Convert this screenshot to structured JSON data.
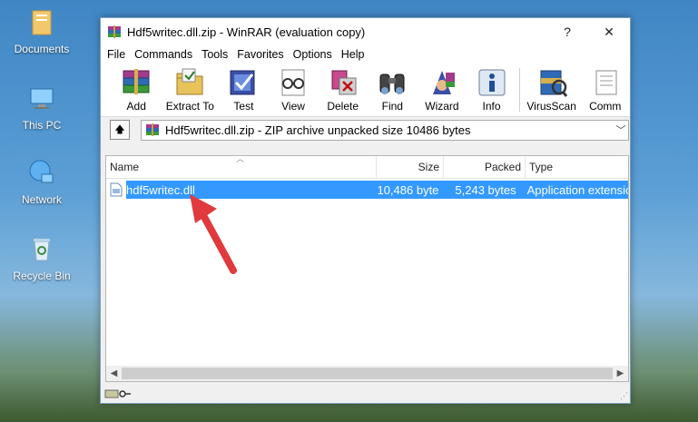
{
  "desktop": {
    "icons": [
      {
        "label": "Documents"
      },
      {
        "label": "This PC"
      },
      {
        "label": "Network"
      },
      {
        "label": "Recycle Bin"
      }
    ]
  },
  "window": {
    "title": "Hdf5writec.dll.zip - WinRAR (evaluation copy)",
    "help_button": "?",
    "close_button": "✕"
  },
  "menu": [
    "File",
    "Commands",
    "Tools",
    "Favorites",
    "Options",
    "Help"
  ],
  "toolbar": [
    {
      "label": "Add",
      "icon": "books-icon"
    },
    {
      "label": "Extract To",
      "icon": "extract-folder-icon"
    },
    {
      "label": "Test",
      "icon": "test-checkmark-icon"
    },
    {
      "label": "View",
      "icon": "glasses-icon"
    },
    {
      "label": "Delete",
      "icon": "delete-icon"
    },
    {
      "label": "Find",
      "icon": "binoculars-icon"
    },
    {
      "label": "Wizard",
      "icon": "wizard-icon"
    },
    {
      "label": "Info",
      "icon": "info-icon"
    },
    {
      "label": "VirusScan",
      "icon": "virusscan-icon"
    },
    {
      "label": "Comm",
      "icon": "comment-icon"
    }
  ],
  "address": {
    "text": "Hdf5writec.dll.zip - ZIP archive unpacked size 10486 bytes"
  },
  "columns": [
    "Name",
    "Size",
    "Packed",
    "Type"
  ],
  "files": [
    {
      "name": "hdf5writec.dll",
      "size": "10,486 byte",
      "packed": "5,243 bytes",
      "type": "Application extensio"
    }
  ],
  "colors": {
    "selection": "#3399ff",
    "arrow": "#e0393e"
  }
}
